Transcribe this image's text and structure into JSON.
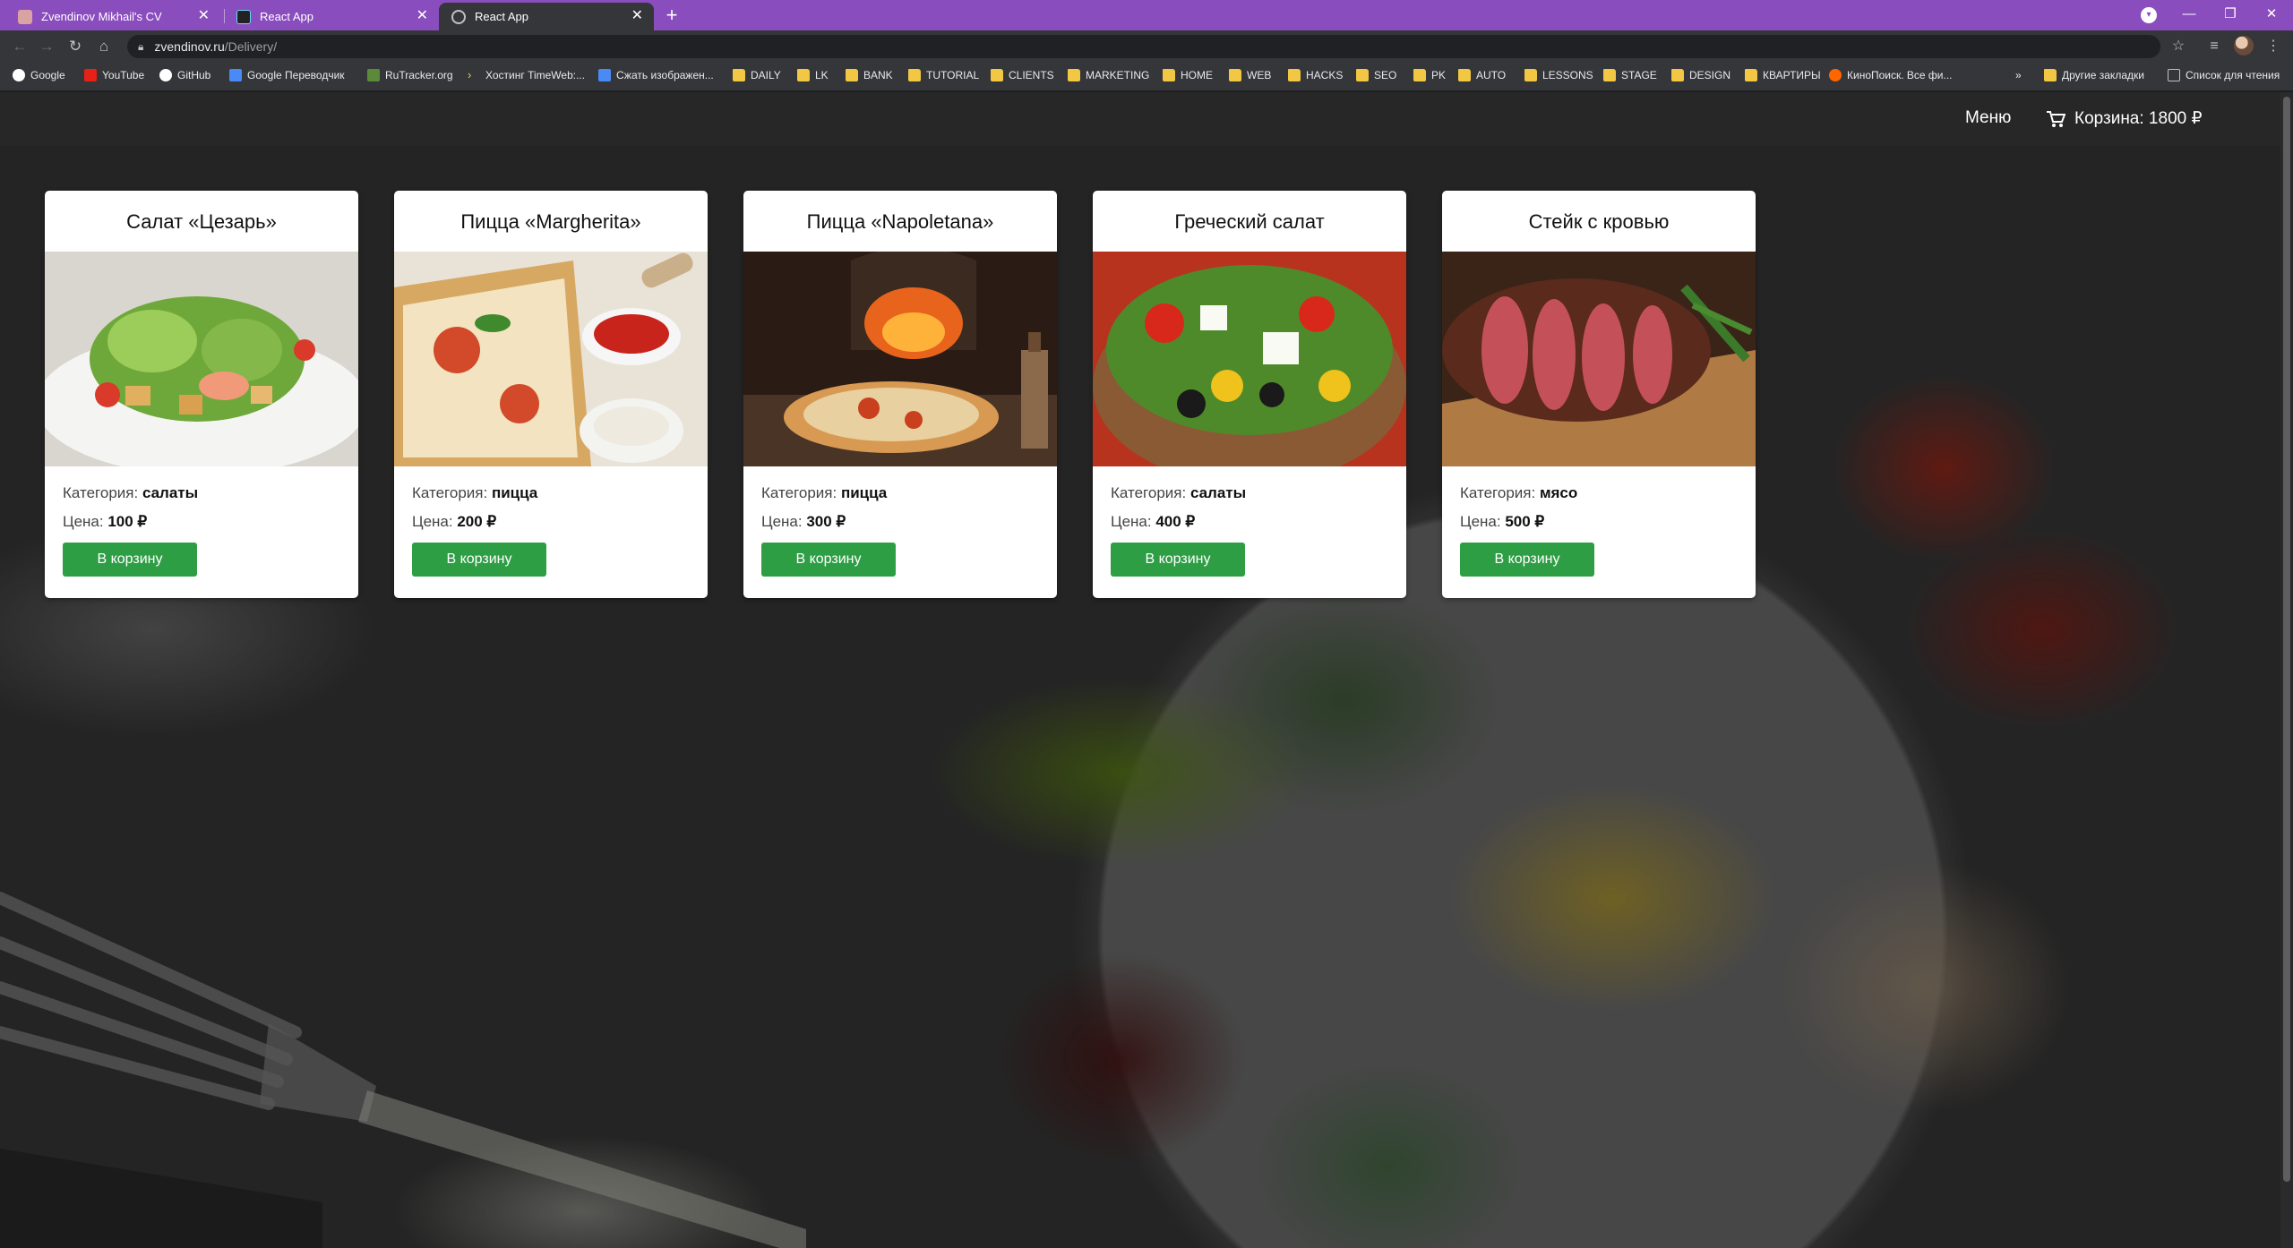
{
  "browser": {
    "tabs": [
      {
        "title": "Zvendinov Mikhail's CV",
        "active": false
      },
      {
        "title": "React App",
        "active": false
      },
      {
        "title": "React App",
        "active": true
      }
    ],
    "url_host": "zvendinov.ru",
    "url_path": "/Delivery/",
    "bookmarks": [
      {
        "label": "Google",
        "icon": "google-icon"
      },
      {
        "label": "YouTube",
        "icon": "youtube-icon"
      },
      {
        "label": "GitHub",
        "icon": "github-icon"
      },
      {
        "label": "Google Переводчик",
        "icon": "translate-icon"
      },
      {
        "label": "RuTracker.org",
        "icon": "rutracker-icon"
      },
      {
        "label": "Хостинг TimeWeb:...",
        "icon": "timeweb-icon"
      },
      {
        "label": "Сжать изображен...",
        "icon": "compress-icon"
      },
      {
        "label": "DAILY",
        "icon": "folder-icon"
      },
      {
        "label": "LK",
        "icon": "folder-icon"
      },
      {
        "label": "BANK",
        "icon": "folder-icon"
      },
      {
        "label": "TUTORIAL",
        "icon": "folder-icon"
      },
      {
        "label": "CLIENTS",
        "icon": "folder-icon"
      },
      {
        "label": "MARKETING",
        "icon": "folder-icon"
      },
      {
        "label": "HOME",
        "icon": "folder-icon"
      },
      {
        "label": "WEB",
        "icon": "folder-icon"
      },
      {
        "label": "HACKS",
        "icon": "folder-icon"
      },
      {
        "label": "SEO",
        "icon": "folder-icon"
      },
      {
        "label": "PK",
        "icon": "folder-icon"
      },
      {
        "label": "AUTO",
        "icon": "folder-icon"
      },
      {
        "label": "LESSONS",
        "icon": "folder-icon"
      },
      {
        "label": "STAGE",
        "icon": "folder-icon"
      },
      {
        "label": "DESIGN",
        "icon": "folder-icon"
      },
      {
        "label": "КВАРТИРЫ",
        "icon": "folder-icon"
      },
      {
        "label": "КиноПоиск. Все фи...",
        "icon": "kinopoisk-icon"
      }
    ],
    "more_bookmarks": "»",
    "other_bookmarks": "Другие закладки",
    "reading_list": "Список для чтения"
  },
  "header": {
    "menu_label": "Меню",
    "cart_label": "Корзина: 1800 ₽"
  },
  "labels": {
    "category": "Категория:",
    "price": "Цена:",
    "add_to_cart": "В корзину"
  },
  "products": [
    {
      "title": "Салат «Цезарь»",
      "category": "салаты",
      "price": "100 ₽"
    },
    {
      "title": "Пицца «Margherita»",
      "category": "пицца",
      "price": "200 ₽"
    },
    {
      "title": "Пицца «Napoletana»",
      "category": "пицца",
      "price": "300 ₽"
    },
    {
      "title": "Греческий салат",
      "category": "салаты",
      "price": "400 ₽"
    },
    {
      "title": "Стейк с кровью",
      "category": "мясо",
      "price": "500 ₽"
    }
  ],
  "colors": {
    "tabbar": "#8a4dbd",
    "button": "#2e9e44",
    "folder": "#f2c744"
  }
}
